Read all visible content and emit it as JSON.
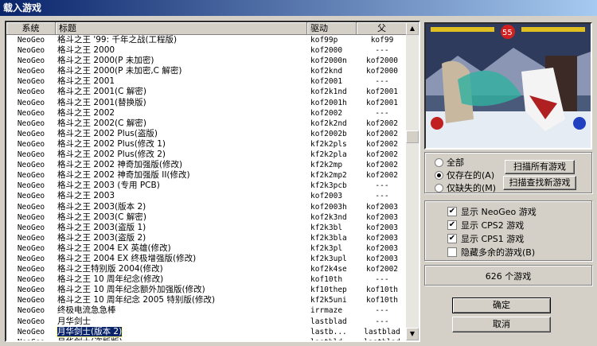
{
  "window": {
    "title": "载入游戏"
  },
  "list": {
    "columns": [
      "系统",
      "标题",
      "驱动",
      "父"
    ],
    "rows": [
      {
        "sys": "NeoGeo",
        "title": "格斗之王 '99: 千年之战(工程版)",
        "driver": "kof99p",
        "parent": "kof99"
      },
      {
        "sys": "NeoGeo",
        "title": "格斗之王 2000",
        "driver": "kof2000",
        "parent": "---"
      },
      {
        "sys": "NeoGeo",
        "title": "格斗之王 2000(P 未加密)",
        "driver": "kof2000n",
        "parent": "kof2000"
      },
      {
        "sys": "NeoGeo",
        "title": "格斗之王 2000(P 未加密,C 解密)",
        "driver": "kof2knd",
        "parent": "kof2000"
      },
      {
        "sys": "NeoGeo",
        "title": "格斗之王 2001",
        "driver": "kof2001",
        "parent": "---"
      },
      {
        "sys": "NeoGeo",
        "title": "格斗之王 2001(C 解密)",
        "driver": "kof2k1nd",
        "parent": "kof2001"
      },
      {
        "sys": "NeoGeo",
        "title": "格斗之王 2001(替换版)",
        "driver": "kof2001h",
        "parent": "kof2001"
      },
      {
        "sys": "NeoGeo",
        "title": "格斗之王 2002",
        "driver": "kof2002",
        "parent": "---"
      },
      {
        "sys": "NeoGeo",
        "title": "格斗之王 2002(C 解密)",
        "driver": "kof2k2nd",
        "parent": "kof2002"
      },
      {
        "sys": "NeoGeo",
        "title": "格斗之王 2002 Plus(盗版)",
        "driver": "kof2002b",
        "parent": "kof2002"
      },
      {
        "sys": "NeoGeo",
        "title": "格斗之王 2002 Plus(修改 1)",
        "driver": "kf2k2pls",
        "parent": "kof2002"
      },
      {
        "sys": "NeoGeo",
        "title": "格斗之王 2002 Plus(修改 2)",
        "driver": "kf2k2pla",
        "parent": "kof2002"
      },
      {
        "sys": "NeoGeo",
        "title": "格斗之王 2002 神奇加强版(修改)",
        "driver": "kf2k2mp",
        "parent": "kof2002"
      },
      {
        "sys": "NeoGeo",
        "title": "格斗之王 2002 神奇加强版 II(修改)",
        "driver": "kf2k2mp2",
        "parent": "kof2002"
      },
      {
        "sys": "NeoGeo",
        "title": "格斗之王 2003 (专用 PCB)",
        "driver": "kf2k3pcb",
        "parent": "---"
      },
      {
        "sys": "NeoGeo",
        "title": "格斗之王 2003",
        "driver": "kof2003",
        "parent": "---"
      },
      {
        "sys": "NeoGeo",
        "title": "格斗之王 2003(版本 2)",
        "driver": "kof2003h",
        "parent": "kof2003"
      },
      {
        "sys": "NeoGeo",
        "title": "格斗之王 2003(C 解密)",
        "driver": "kof2k3nd",
        "parent": "kof2003"
      },
      {
        "sys": "NeoGeo",
        "title": "格斗之王 2003(盗版 1)",
        "driver": "kf2k3bl",
        "parent": "kof2003"
      },
      {
        "sys": "NeoGeo",
        "title": "格斗之王 2003(盗版 2)",
        "driver": "kf2k3bla",
        "parent": "kof2003"
      },
      {
        "sys": "NeoGeo",
        "title": "格斗之王 2004 EX 英雄(修改)",
        "driver": "kf2k3pl",
        "parent": "kof2003"
      },
      {
        "sys": "NeoGeo",
        "title": "格斗之王 2004 EX 终极增强版(修改)",
        "driver": "kf2k3upl",
        "parent": "kof2003"
      },
      {
        "sys": "NeoGeo",
        "title": "格斗之王特别版 2004(修改)",
        "driver": "kof2k4se",
        "parent": "kof2002"
      },
      {
        "sys": "NeoGeo",
        "title": "格斗之王 10 周年纪念(修改)",
        "driver": "kof10th",
        "parent": "---"
      },
      {
        "sys": "NeoGeo",
        "title": "格斗之王 10 周年纪念额外加强版(修改)",
        "driver": "kf10thep",
        "parent": "kof10th"
      },
      {
        "sys": "NeoGeo",
        "title": "格斗之王 10 周年纪念 2005 特别版(修改)",
        "driver": "kf2k5uni",
        "parent": "kof10th"
      },
      {
        "sys": "NeoGeo",
        "title": "终极电流急急棒",
        "driver": "irrmaze",
        "parent": "---"
      },
      {
        "sys": "NeoGeo",
        "title": "月华剑士",
        "driver": "lastblad",
        "parent": "---"
      },
      {
        "sys": "NeoGeo",
        "title": "月华剑士(版本 2)",
        "driver": "lastb...",
        "parent": "lastblad",
        "selected": true
      },
      {
        "sys": "NeoGeo",
        "title": "月华剑士(盗版版)",
        "driver": "lastbld",
        "parent": "lastblad"
      }
    ]
  },
  "filter": {
    "options": [
      "全部",
      "仅存在的(A)",
      "仅缺失的(M)"
    ],
    "selected": 1,
    "scan_all_label": "扫描所有游戏",
    "scan_new_label": "扫描查找新游戏"
  },
  "systems": [
    {
      "label": "显示 NeoGeo 游戏",
      "checked": true
    },
    {
      "label": "显示 CPS2 游戏",
      "checked": true
    },
    {
      "label": "显示 CPS1 游戏",
      "checked": true
    },
    {
      "label": "隐藏多余的游戏(B)",
      "checked": false
    }
  ],
  "count_text": "626 个游戏",
  "ok_label": "确定",
  "cancel_label": "取消",
  "colors": {
    "titlebar": "#0a246a",
    "selection": "#0a246a"
  },
  "preview": {
    "timer": "55"
  }
}
